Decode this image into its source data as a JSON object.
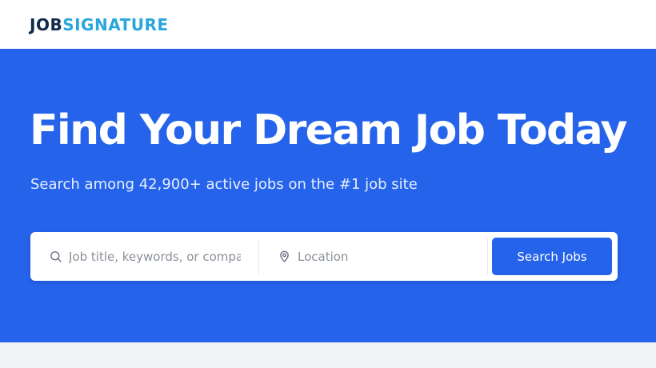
{
  "header": {
    "logo_part1": "JOB",
    "logo_part2": "SIGNATURE"
  },
  "hero": {
    "title": "Find Your Dream Job Today",
    "subtitle": "Search among 42,900+ active jobs on the  #1 job site"
  },
  "search": {
    "keyword_placeholder": "Job title, keywords, or company",
    "keyword_icon": "search-icon",
    "location_placeholder": "Location",
    "location_icon": "map-pin-icon",
    "button_label": "Search Jobs"
  },
  "colors": {
    "brand_blue": "#2563eb",
    "logo_dark": "#0f2a4a",
    "logo_light": "#2aa6dc",
    "page_bg": "#f3f4f6"
  }
}
